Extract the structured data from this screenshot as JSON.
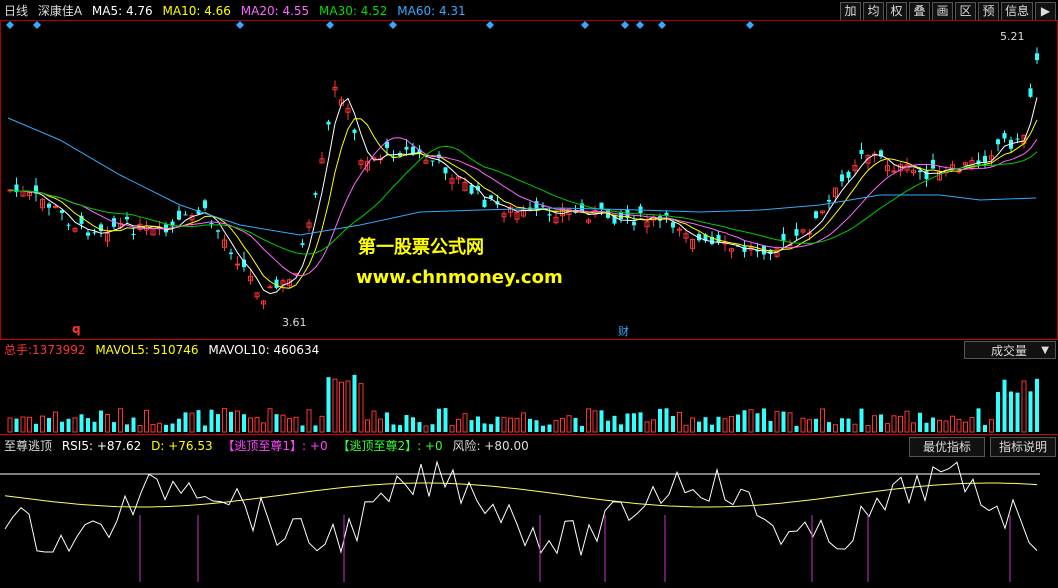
{
  "header": {
    "period": "日线",
    "stock": "深康佳A",
    "ma5": "MA5: 4.76",
    "ma10": "MA10: 4.66",
    "ma20": "MA20: 4.55",
    "ma30": "MA30: 4.52",
    "ma60": "MA60: 4.31"
  },
  "toolbar": [
    "加",
    "均",
    "权",
    "叠",
    "画",
    "区",
    "预",
    "信息"
  ],
  "price_labels": {
    "high": "5.21",
    "low": "3.61",
    "q_mark": "q",
    "cai_mark": "财"
  },
  "volume": {
    "label": "总手:",
    "value": "1373992",
    "mavol5": "MAVOL5: 510746",
    "mavol10": "MAVOL10: 460634",
    "selector": "成交量"
  },
  "indicator": {
    "name": "至尊逃顶",
    "rsi5": "RSI5: +87.62",
    "d": "D: +76.53",
    "top1": "【逃顶至尊1】: +0",
    "top2": "【逃顶至尊2】: +0",
    "risk": "风险: +80.00",
    "best_button": "最优指标",
    "help_button": "指标说明"
  },
  "watermark": {
    "line1": "第一股票公式网",
    "line2": "www.chnmoney.com"
  },
  "colors": {
    "ma5": "#ffffff",
    "ma10": "#ffff00",
    "ma20": "#ff66ff",
    "ma30": "#00cc00",
    "ma60": "#33aaff",
    "up": "#ff3333",
    "down": "#33ffff",
    "frame": "#cc0000"
  }
}
